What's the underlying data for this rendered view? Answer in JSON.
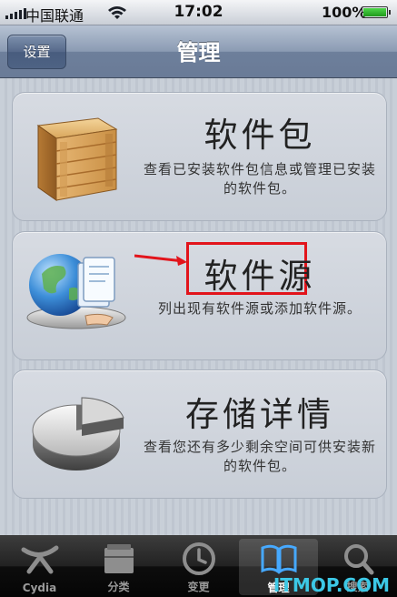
{
  "status_bar": {
    "carrier": "中国联通",
    "time": "17:02",
    "battery": "100%",
    "battery_level": 1.0,
    "signal_icon": "signal-bars-icon",
    "wifi_icon": "wifi-icon"
  },
  "nav": {
    "back_label": "设置",
    "title": "管理"
  },
  "sections": [
    {
      "title": "软件包",
      "description": "查看已安装软件包信息或管理已安装的软件包。",
      "icon": "package-box-icon"
    },
    {
      "title": "软件源",
      "description": "列出现有软件源或添加软件源。",
      "icon": "sources-globe-icon",
      "highlighted": true,
      "annotation_color": "#e2141b"
    },
    {
      "title": "存储详情",
      "description": "查看您还有多少剩余空间可供安装新的软件包。",
      "icon": "storage-pie-icon"
    }
  ],
  "tabs": [
    {
      "label": "Cydia",
      "icon": "cydia-icon",
      "active": false
    },
    {
      "label": "分类",
      "icon": "sections-icon",
      "active": false
    },
    {
      "label": "变更",
      "icon": "clock-icon",
      "active": false
    },
    {
      "label": "管理",
      "icon": "book-icon",
      "active": true
    },
    {
      "label": "搜索",
      "icon": "search-icon",
      "active": false
    }
  ],
  "watermark": "ITMOP.COM",
  "colors": {
    "nav_bar": "#8b9bb3",
    "tab_bar": "#111111",
    "annotation": "#e2141b",
    "watermark": "#3cc8e6"
  }
}
